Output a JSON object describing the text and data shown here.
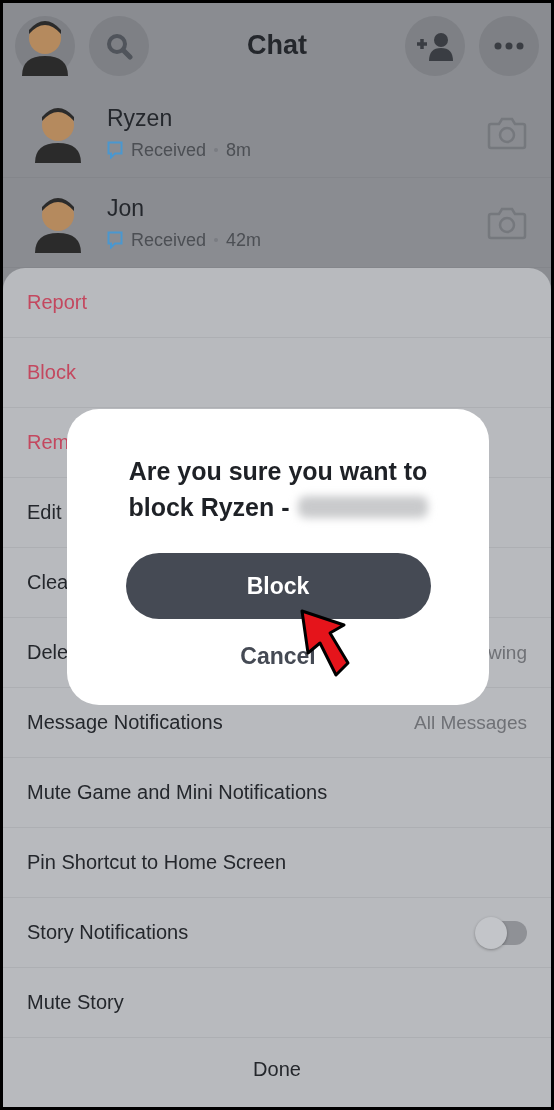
{
  "header": {
    "title": "Chat"
  },
  "chats": [
    {
      "name": "Ryzen",
      "status": "Received",
      "time": "8m"
    },
    {
      "name": "Jon",
      "status": "Received",
      "time": "42m"
    }
  ],
  "menu": [
    {
      "label": "Report",
      "kind": "danger"
    },
    {
      "label": "Block",
      "kind": "danger"
    },
    {
      "label": "Rem",
      "kind": "danger"
    },
    {
      "label": "Edit",
      "kind": "plain"
    },
    {
      "label": "Clea",
      "kind": "plain"
    },
    {
      "label": "Dele",
      "kind": "value",
      "value": "wing"
    },
    {
      "label": "Message Notifications",
      "kind": "value",
      "value": "All Messages"
    },
    {
      "label": "Mute Game and Mini Notifications",
      "kind": "plain"
    },
    {
      "label": "Pin Shortcut to Home Screen",
      "kind": "plain"
    },
    {
      "label": "Story Notifications",
      "kind": "toggle",
      "on": false
    },
    {
      "label": "Mute Story",
      "kind": "plain"
    }
  ],
  "done": "Done",
  "dialog": {
    "message_lines": [
      "Are you sure you want to",
      "block Ryzen -"
    ],
    "confirm": "Block",
    "cancel": "Cancel"
  }
}
